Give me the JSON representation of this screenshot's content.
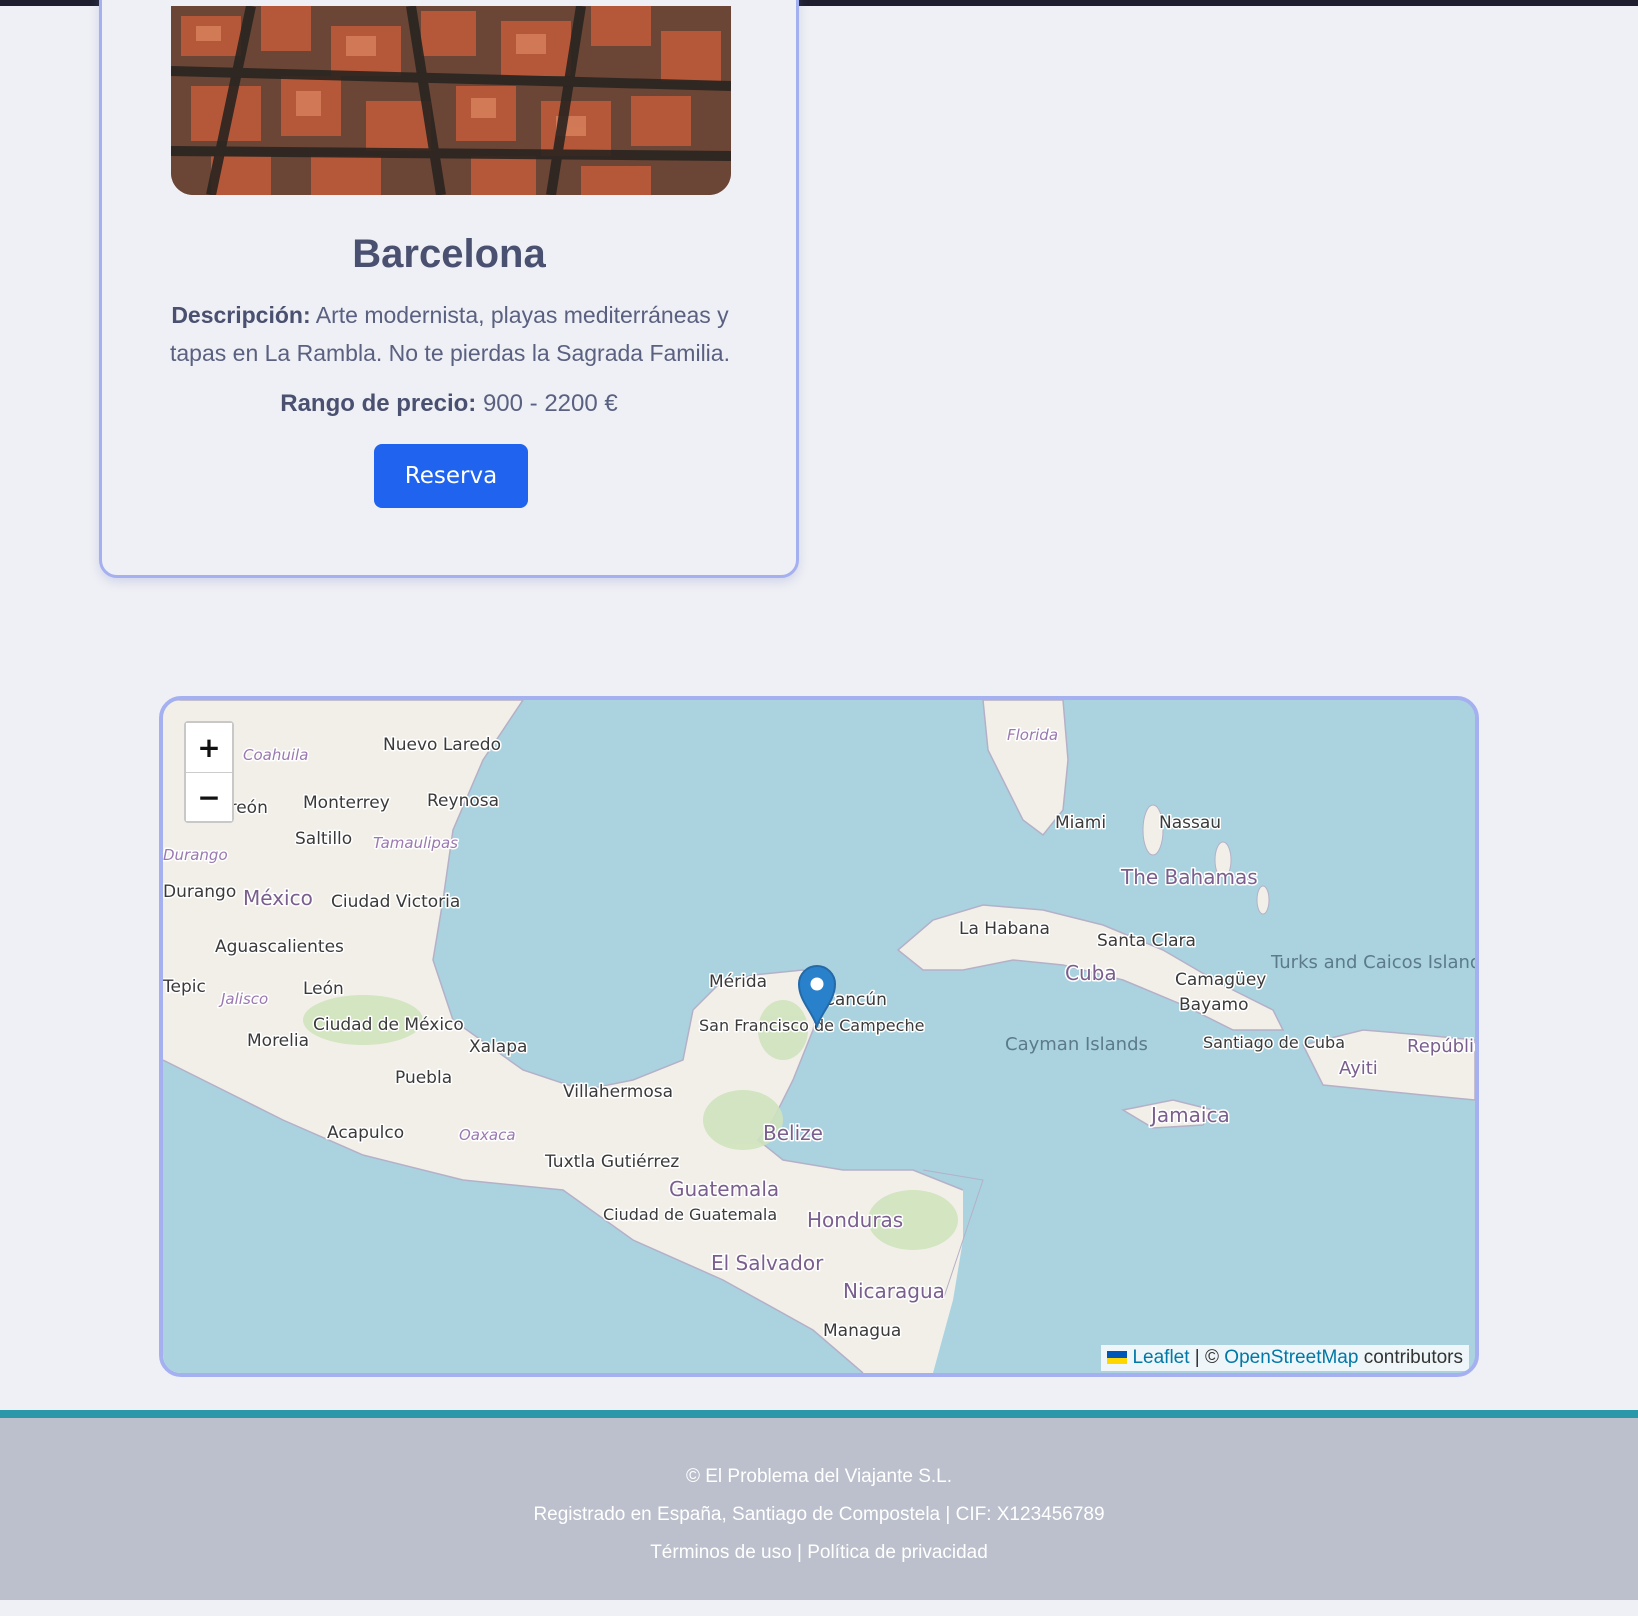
{
  "card": {
    "title": "Barcelona",
    "description_label": "Descripción:",
    "description_text": "Arte modernista, playas mediterráneas y tapas en La Rambla. No te pierdas la Sagrada Familia.",
    "price_label": "Rango de precio:",
    "price_value": "900 - 2200 €",
    "button_label": "Reserva"
  },
  "map": {
    "zoom_in": "+",
    "zoom_out": "−",
    "attribution": {
      "leaflet": "Leaflet",
      "separator": "| ©",
      "osm": "OpenStreetMap",
      "contributors": "contributors"
    },
    "marker_color": "#2a81cb",
    "labels": {
      "countries": [
        "México",
        "Cuba",
        "Belize",
        "Guatemala",
        "Honduras",
        "El Salvador",
        "Nicaragua",
        "The Bahamas",
        "Jamaica",
        "Cayman Islands",
        "Turks and Caicos Islands",
        "República Dominicana",
        "Ayiti"
      ],
      "regions": [
        "Coahuila",
        "Tamaulipas",
        "Durango",
        "Jalisco",
        "Oaxaca",
        "Florida"
      ],
      "cities": [
        "Nuevo Laredo",
        "Monterrey",
        "Reynosa",
        "Torreón",
        "Saltillo",
        "Durango",
        "Ciudad Victoria",
        "Aguascalientes",
        "Tepic",
        "León",
        "Ciudad de México",
        "Morelia",
        "Xalapa",
        "Puebla",
        "Acapulco",
        "Villahermosa",
        "Tuxtla Gutiérrez",
        "Mérida",
        "Cancún",
        "San Francisco de Campeche",
        "Ciudad de Guatemala",
        "Managua",
        "Miami",
        "Nassau",
        "La Habana",
        "Santa Clara",
        "Camagüey",
        "Bayamo",
        "Santiago de Cuba"
      ]
    }
  },
  "footer": {
    "copyright": "© El Problema del Viajante S.L.",
    "registration": "Registrado en España, Santiago de Compostela | CIF: X123456789",
    "terms": "Términos de uso",
    "divider": "|",
    "privacy": "Política de privacidad"
  }
}
